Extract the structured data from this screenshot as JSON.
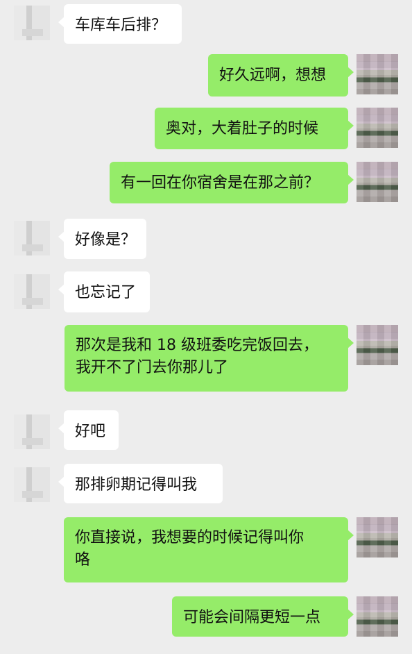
{
  "messages": [
    {
      "side": "left",
      "text": "车库车后排？"
    },
    {
      "side": "right",
      "text": "好久远啊，想想"
    },
    {
      "side": "right",
      "text": "奥对，大着肚子的时候"
    },
    {
      "side": "right",
      "text": "有一回在你宿舍是在那之前？"
    },
    {
      "side": "left",
      "text": "好像是？"
    },
    {
      "side": "left",
      "text": "也忘记了"
    },
    {
      "side": "right",
      "line1": "那次是我和 18 级班委吃完饭回去，",
      "line2": "我开不了门去你那儿了"
    },
    {
      "side": "left",
      "text": "好吧"
    },
    {
      "side": "left",
      "text": "那排卵期记得叫我"
    },
    {
      "side": "right",
      "line1": "你直接说，我想要的时候记得叫你",
      "line2": "咯"
    },
    {
      "side": "right",
      "text": "可能会间隔更短一点"
    }
  ],
  "colors": {
    "background": "#ededed",
    "incoming_bubble": "#ffffff",
    "outgoing_bubble": "#95ec69"
  }
}
